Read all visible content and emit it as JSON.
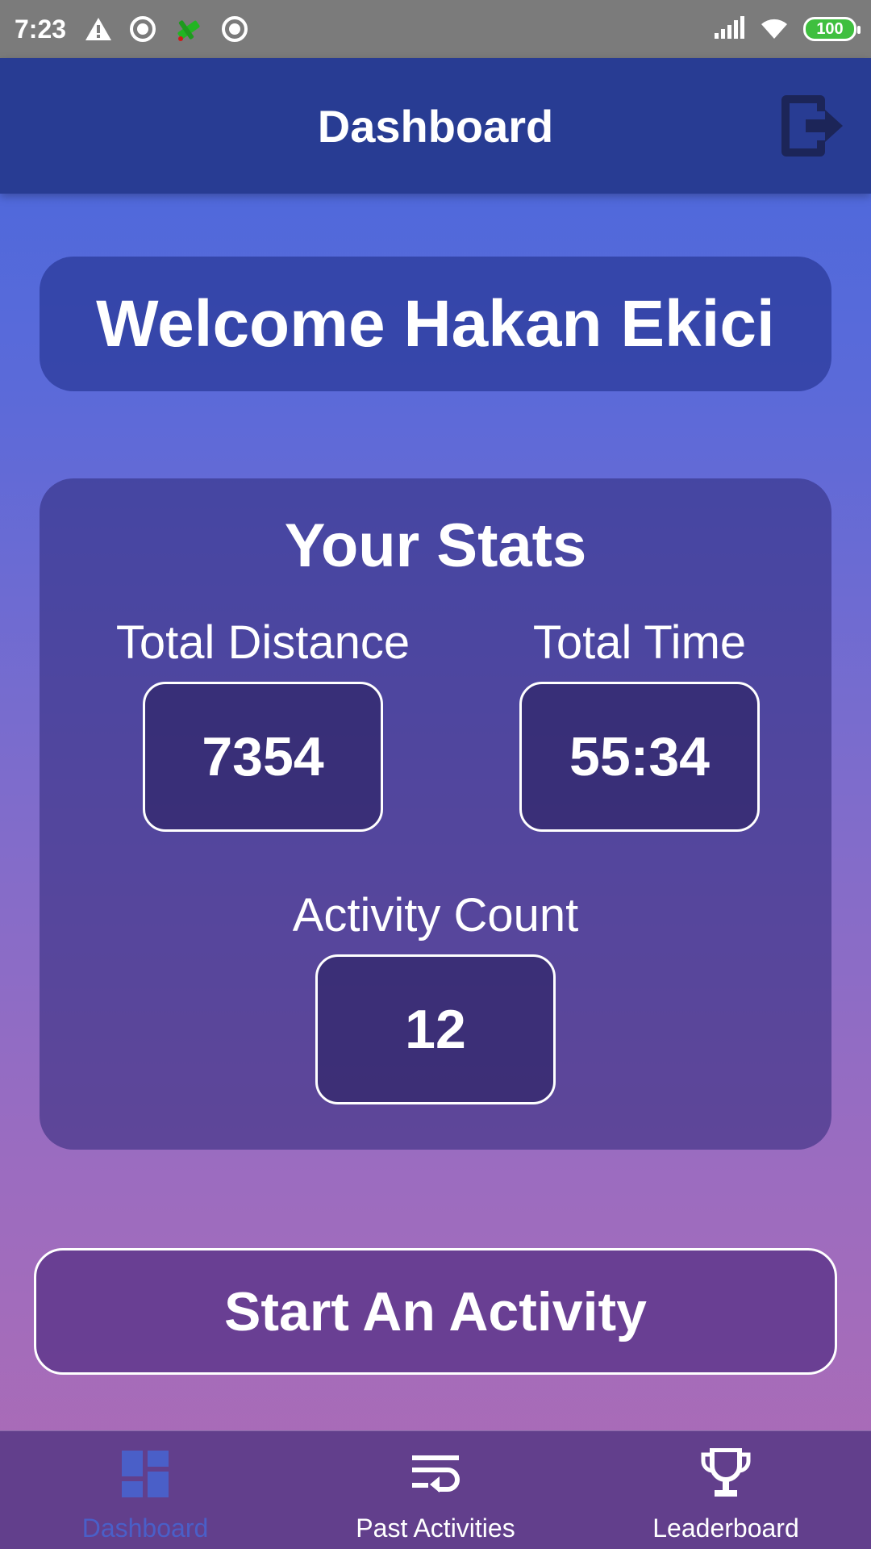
{
  "status_bar": {
    "time": "7:23",
    "battery": "100"
  },
  "app_bar": {
    "title": "Dashboard"
  },
  "welcome": {
    "text": "Welcome Hakan Ekici"
  },
  "stats": {
    "title": "Your Stats",
    "total_distance": {
      "label": "Total Distance",
      "value": "7354"
    },
    "total_time": {
      "label": "Total Time",
      "value": "55:34"
    },
    "activity_count": {
      "label": "Activity Count",
      "value": "12"
    }
  },
  "start_button": {
    "label": "Start An Activity"
  },
  "bottom_nav": {
    "items": [
      {
        "label": "Dashboard",
        "icon": "dashboard-icon",
        "active": true
      },
      {
        "label": "Past Activities",
        "icon": "list-return-icon",
        "active": false
      },
      {
        "label": "Leaderboard",
        "icon": "trophy-icon",
        "active": false
      }
    ]
  },
  "colors": {
    "app_bar": "#283c93",
    "nav_bar": "#623f8c",
    "active_nav": "#4a5fc8",
    "gradient_top": "#4568dd",
    "gradient_bottom": "#ae6bb4"
  }
}
